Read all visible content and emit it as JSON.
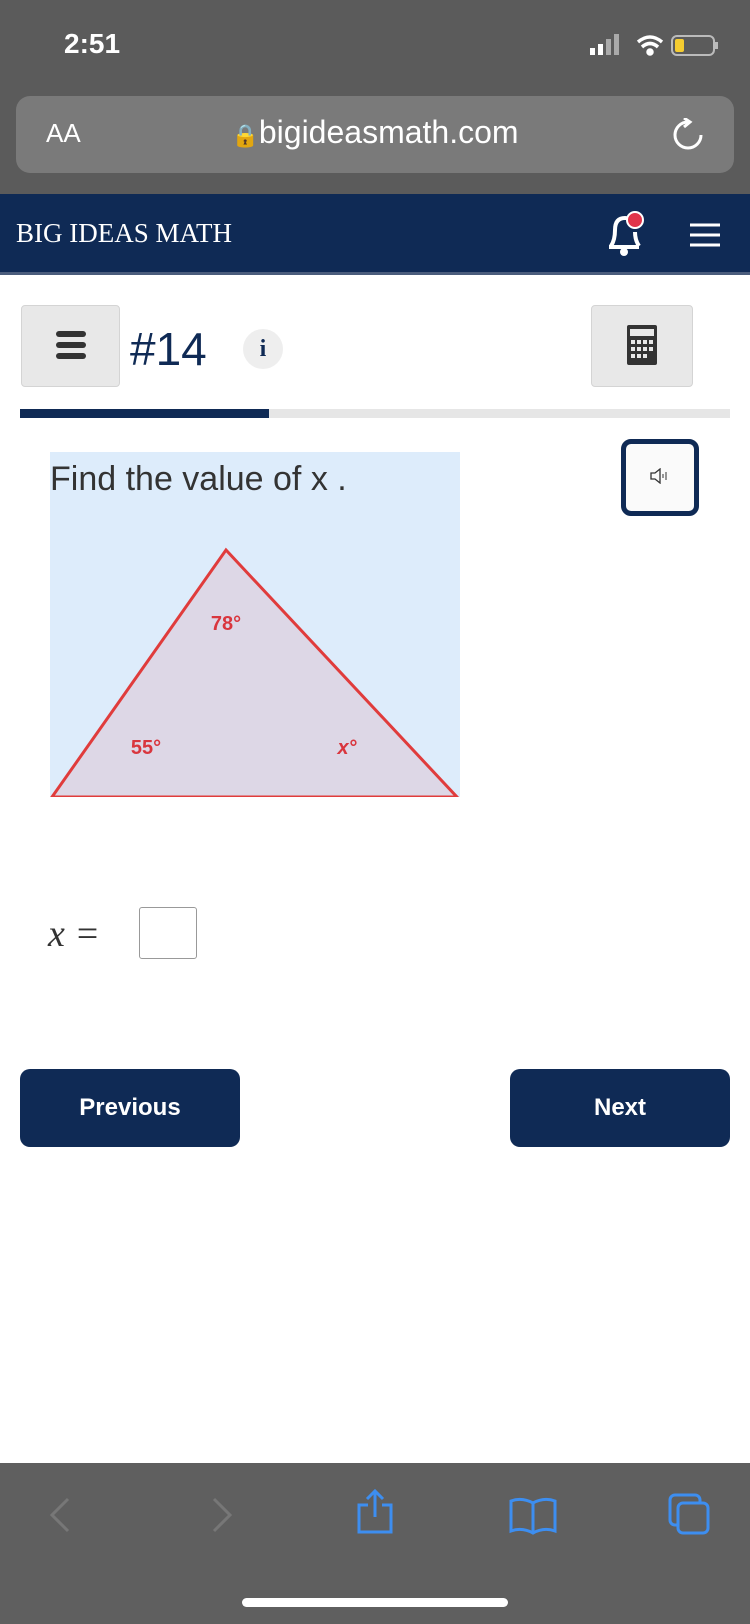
{
  "status_bar": {
    "time": "2:51"
  },
  "browser": {
    "text_size_label": "AA",
    "url": "bigideasmath.com"
  },
  "app_header": {
    "brand": "BIG IDEAS MATH"
  },
  "question": {
    "number": "#14",
    "info_label": "i",
    "progress": 0.35,
    "prompt": "Find the value of x .",
    "figure": {
      "angle_top": "78°",
      "angle_left": "55°",
      "angle_right": "x°"
    },
    "answer_label": "x =",
    "answer_value": ""
  },
  "buttons": {
    "previous": "Previous",
    "next": "Next"
  },
  "colors": {
    "brand": "#0f2a55",
    "triangle": "#e03c3c",
    "question_bg": "#ddecfb"
  }
}
